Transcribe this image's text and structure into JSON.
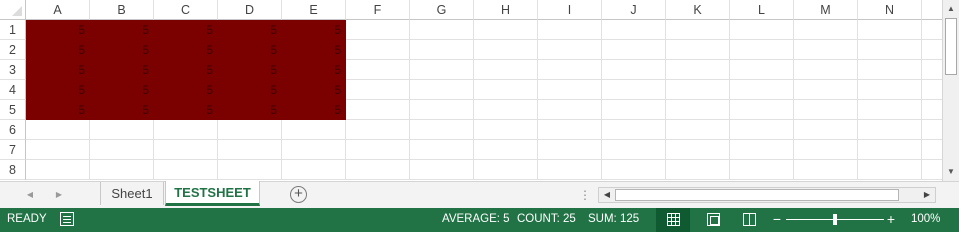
{
  "grid": {
    "columns": [
      "A",
      "B",
      "C",
      "D",
      "E",
      "F",
      "G",
      "H",
      "I",
      "J",
      "K",
      "L",
      "M",
      "N",
      ""
    ],
    "rows": [
      "1",
      "2",
      "3",
      "4",
      "5",
      "6",
      "7",
      "8"
    ],
    "cells": [
      [
        "5",
        "5",
        "5",
        "5",
        "5",
        "",
        "",
        "",
        "",
        "",
        "",
        "",
        "",
        "",
        ""
      ],
      [
        "5",
        "5",
        "5",
        "5",
        "5",
        "",
        "",
        "",
        "",
        "",
        "",
        "",
        "",
        "",
        ""
      ],
      [
        "5",
        "5",
        "5",
        "5",
        "5",
        "",
        "",
        "",
        "",
        "",
        "",
        "",
        "",
        "",
        ""
      ],
      [
        "5",
        "5",
        "5",
        "5",
        "5",
        "",
        "",
        "",
        "",
        "",
        "",
        "",
        "",
        "",
        ""
      ],
      [
        "5",
        "5",
        "5",
        "5",
        "5",
        "",
        "",
        "",
        "",
        "",
        "",
        "",
        "",
        "",
        ""
      ],
      [
        "",
        "",
        "",
        "",
        "",
        "",
        "",
        "",
        "",
        "",
        "",
        "",
        "",
        "",
        ""
      ],
      [
        "",
        "",
        "",
        "",
        "",
        "",
        "",
        "",
        "",
        "",
        "",
        "",
        "",
        "",
        ""
      ],
      [
        "",
        "",
        "",
        "",
        "",
        "",
        "",
        "",
        "",
        "",
        "",
        "",
        "",
        "",
        ""
      ]
    ],
    "fill_color": "#7b0000",
    "filled_range": "A1:E5"
  },
  "sheet_tabs": {
    "tabs": [
      "Sheet1",
      "TESTSHEET"
    ],
    "active": "TESTSHEET",
    "add_icon": "plus-circle-icon"
  },
  "status_bar": {
    "mode": "READY",
    "average": "AVERAGE: 5",
    "count": "COUNT: 25",
    "sum": "SUM: 125",
    "zoom": "100%",
    "zoom_fraction": 0.5,
    "accent_color": "#217346"
  }
}
